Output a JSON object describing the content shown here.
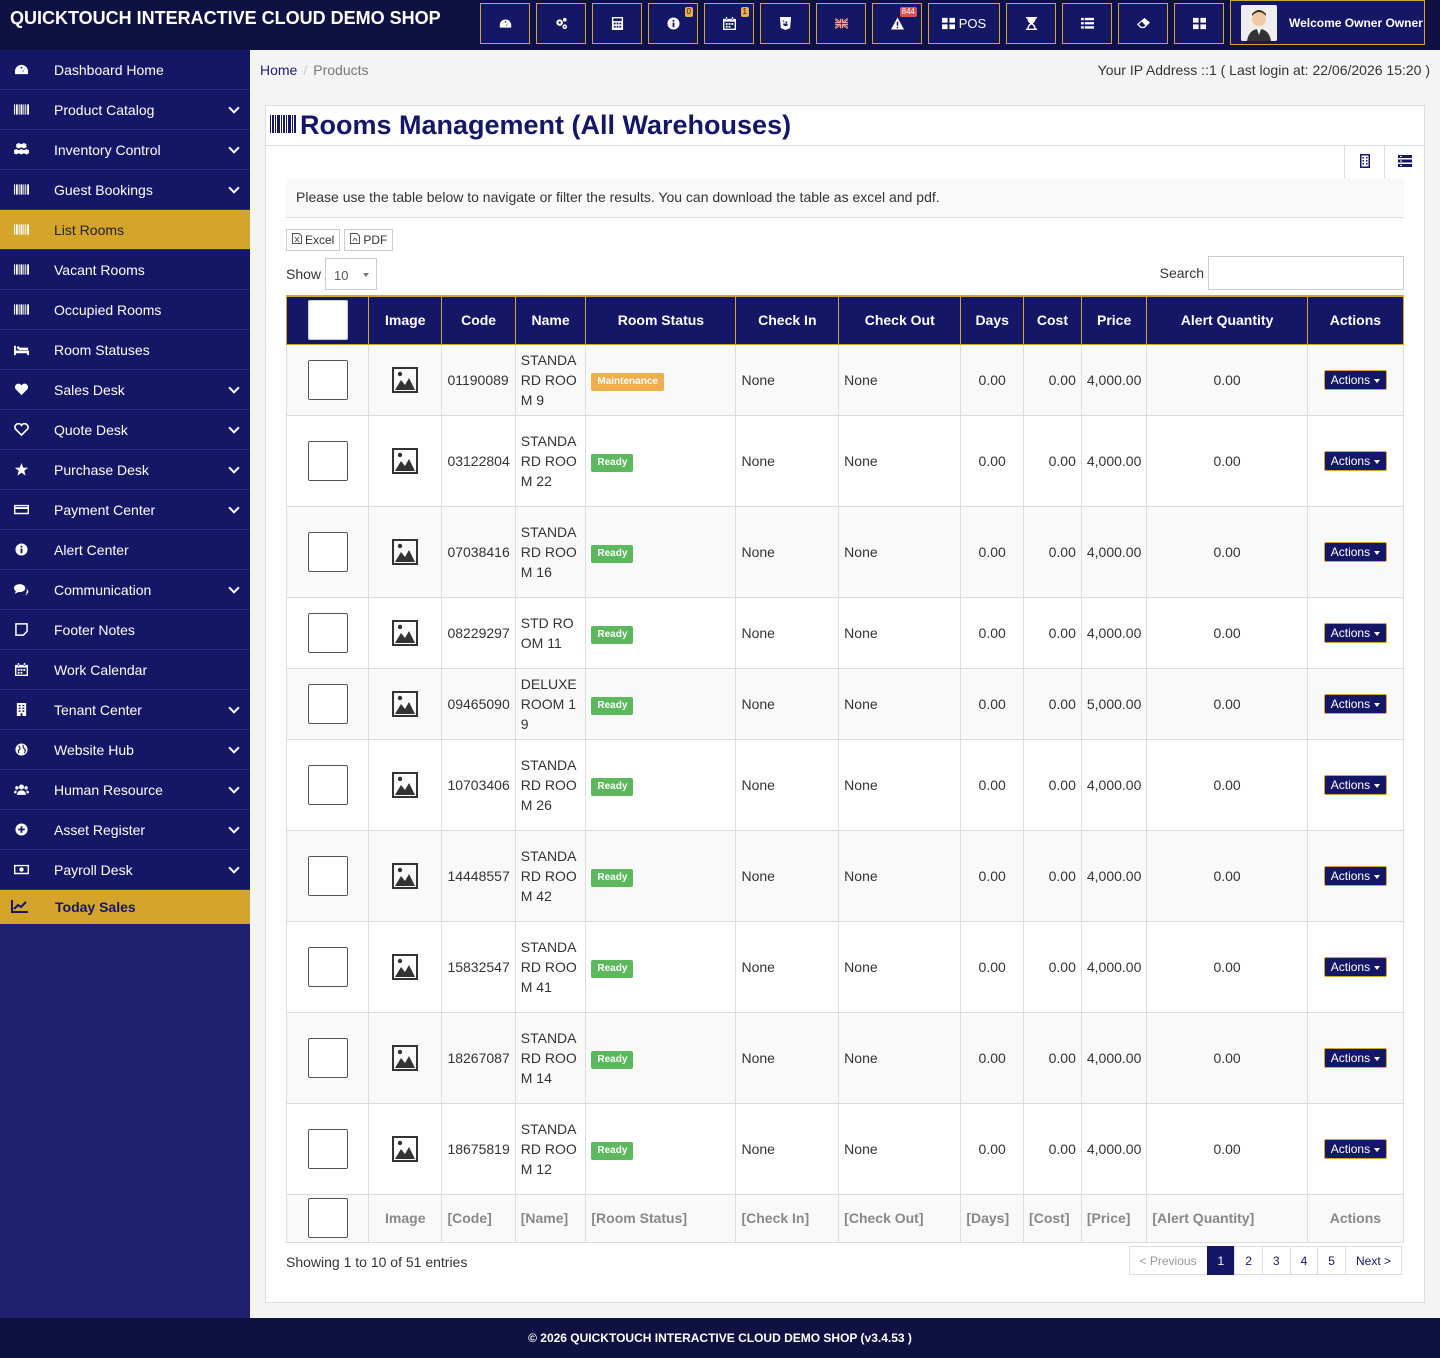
{
  "app": {
    "brand": "QUICKTOUCH INTERACTIVE CLOUD DEMO SHOP",
    "welcome": "Welcome Owner Owner"
  },
  "topbar": {
    "buttons": [
      {
        "icon": "dashboard-icon"
      },
      {
        "icon": "cogs-icon"
      },
      {
        "icon": "calculator-icon"
      },
      {
        "icon": "info-icon",
        "badge": "0"
      },
      {
        "icon": "calendar-icon",
        "badge": "1"
      },
      {
        "icon": "css-icon"
      },
      {
        "icon": "flag-uk-icon"
      },
      {
        "icon": "warning-icon",
        "badge": "844"
      },
      {
        "icon": "pos-icon",
        "label": "POS"
      },
      {
        "icon": "hourglass-icon"
      },
      {
        "icon": "list-icon"
      },
      {
        "icon": "eraser-icon"
      },
      {
        "icon": "grid-icon"
      }
    ]
  },
  "sidebar": {
    "items": [
      {
        "label": "Dashboard Home",
        "icon": "dashboard-icon",
        "chevron": false
      },
      {
        "label": "Product Catalog",
        "icon": "barcode-icon",
        "chevron": true
      },
      {
        "label": "Inventory Control",
        "icon": "cubes-icon",
        "chevron": true
      },
      {
        "label": "Guest Bookings",
        "icon": "barcode-icon",
        "chevron": true
      },
      {
        "label": "List Rooms",
        "icon": "barcode-icon",
        "chevron": false,
        "active": true
      },
      {
        "label": "Vacant Rooms",
        "icon": "barcode-icon",
        "chevron": false
      },
      {
        "label": "Occupied Rooms",
        "icon": "barcode-icon",
        "chevron": false
      },
      {
        "label": "Room Statuses",
        "icon": "bed-icon",
        "chevron": false
      },
      {
        "label": "Sales Desk",
        "icon": "heart-icon",
        "chevron": true
      },
      {
        "label": "Quote Desk",
        "icon": "heart-outline-icon",
        "chevron": true
      },
      {
        "label": "Purchase Desk",
        "icon": "star-icon",
        "chevron": true
      },
      {
        "label": "Payment Center",
        "icon": "credit-card-icon",
        "chevron": true
      },
      {
        "label": "Alert Center",
        "icon": "info-icon",
        "chevron": false
      },
      {
        "label": "Communication",
        "icon": "comments-icon",
        "chevron": true
      },
      {
        "label": "Footer Notes",
        "icon": "note-icon",
        "chevron": false
      },
      {
        "label": "Work Calendar",
        "icon": "calendar-icon",
        "chevron": false
      },
      {
        "label": "Tenant Center",
        "icon": "building-icon",
        "chevron": true
      },
      {
        "label": "Website Hub",
        "icon": "globe-icon",
        "chevron": true
      },
      {
        "label": "Human Resource",
        "icon": "users-icon",
        "chevron": true
      },
      {
        "label": "Asset Register",
        "icon": "plus-circle-icon",
        "chevron": true
      },
      {
        "label": "Payroll Desk",
        "icon": "money-icon",
        "chevron": true
      }
    ],
    "today_sales": "Today Sales"
  },
  "breadcrumb": {
    "home": "Home",
    "current": "Products"
  },
  "ip_info": "Your IP Address ::1 ( Last login at: 22/06/2026 15:20 )",
  "page": {
    "title": "Rooms Management (All Warehouses)",
    "intro": "Please use the table below to navigate or filter the results. You can download the table as excel and pdf.",
    "excel": "Excel",
    "pdf": "PDF",
    "show_label": "Show",
    "show_value": "10",
    "search_label": "Search",
    "search_value": ""
  },
  "table": {
    "headers": [
      "Image",
      "Code",
      "Name",
      "Room Status",
      "Check In",
      "Check Out",
      "Days",
      "Cost",
      "Price",
      "Alert Quantity",
      "Actions"
    ],
    "rows": [
      {
        "code": "01190089",
        "name": "STANDARD ROOM 9",
        "status": "Maintenance",
        "check_in": "None",
        "check_out": "None",
        "days": "0.00",
        "cost": "0.00",
        "price": "4,000.00",
        "alert": "0.00",
        "action": "Actions"
      },
      {
        "code": "03122804",
        "name": "STANDARD ROOM 22",
        "status": "Ready",
        "check_in": "None",
        "check_out": "None",
        "days": "0.00",
        "cost": "0.00",
        "price": "4,000.00",
        "alert": "0.00",
        "action": "Actions"
      },
      {
        "code": "07038416",
        "name": "STANDARD ROOM 16",
        "status": "Ready",
        "check_in": "None",
        "check_out": "None",
        "days": "0.00",
        "cost": "0.00",
        "price": "4,000.00",
        "alert": "0.00",
        "action": "Actions"
      },
      {
        "code": "08229297",
        "name": "STD ROOM 11",
        "status": "Ready",
        "check_in": "None",
        "check_out": "None",
        "days": "0.00",
        "cost": "0.00",
        "price": "4,000.00",
        "alert": "0.00",
        "action": "Actions"
      },
      {
        "code": "09465090",
        "name": "DELUXE ROOM 19",
        "status": "Ready",
        "check_in": "None",
        "check_out": "None",
        "days": "0.00",
        "cost": "0.00",
        "price": "5,000.00",
        "alert": "0.00",
        "action": "Actions"
      },
      {
        "code": "10703406",
        "name": "STANDARD ROOM 26",
        "status": "Ready",
        "check_in": "None",
        "check_out": "None",
        "days": "0.00",
        "cost": "0.00",
        "price": "4,000.00",
        "alert": "0.00",
        "action": "Actions"
      },
      {
        "code": "14448557",
        "name": "STANDARD ROOM 42",
        "status": "Ready",
        "check_in": "None",
        "check_out": "None",
        "days": "0.00",
        "cost": "0.00",
        "price": "4,000.00",
        "alert": "0.00",
        "action": "Actions"
      },
      {
        "code": "15832547",
        "name": "STANDARD ROOM 41",
        "status": "Ready",
        "check_in": "None",
        "check_out": "None",
        "days": "0.00",
        "cost": "0.00",
        "price": "4,000.00",
        "alert": "0.00",
        "action": "Actions"
      },
      {
        "code": "18267087",
        "name": "STANDARD ROOM 14",
        "status": "Ready",
        "check_in": "None",
        "check_out": "None",
        "days": "0.00",
        "cost": "0.00",
        "price": "4,000.00",
        "alert": "0.00",
        "action": "Actions"
      },
      {
        "code": "18675819",
        "name": "STANDARD ROOM 12",
        "status": "Ready",
        "check_in": "None",
        "check_out": "None",
        "days": "0.00",
        "cost": "0.00",
        "price": "4,000.00",
        "alert": "0.00",
        "action": "Actions"
      }
    ],
    "footer": [
      "Image",
      "[Code]",
      "[Name]",
      "[Room Status]",
      "[Check In]",
      "[Check Out]",
      "[Days]",
      "[Cost]",
      "[Price]",
      "[Alert Quantity]",
      "Actions"
    ]
  },
  "pagination": {
    "info": "Showing 1 to 10 of 51 entries",
    "prev": "< Previous",
    "pages": [
      "1",
      "2",
      "3",
      "4",
      "5"
    ],
    "current": "1",
    "next": "Next >"
  },
  "footer": {
    "text": "© 2026 QUICKTOUCH INTERACTIVE CLOUD DEMO SHOP (v3.4.53 )"
  },
  "colors": {
    "navy": "#141766",
    "gold": "#d4a42b",
    "ready": "#5cb85c",
    "maintenance": "#f0ad4e"
  }
}
